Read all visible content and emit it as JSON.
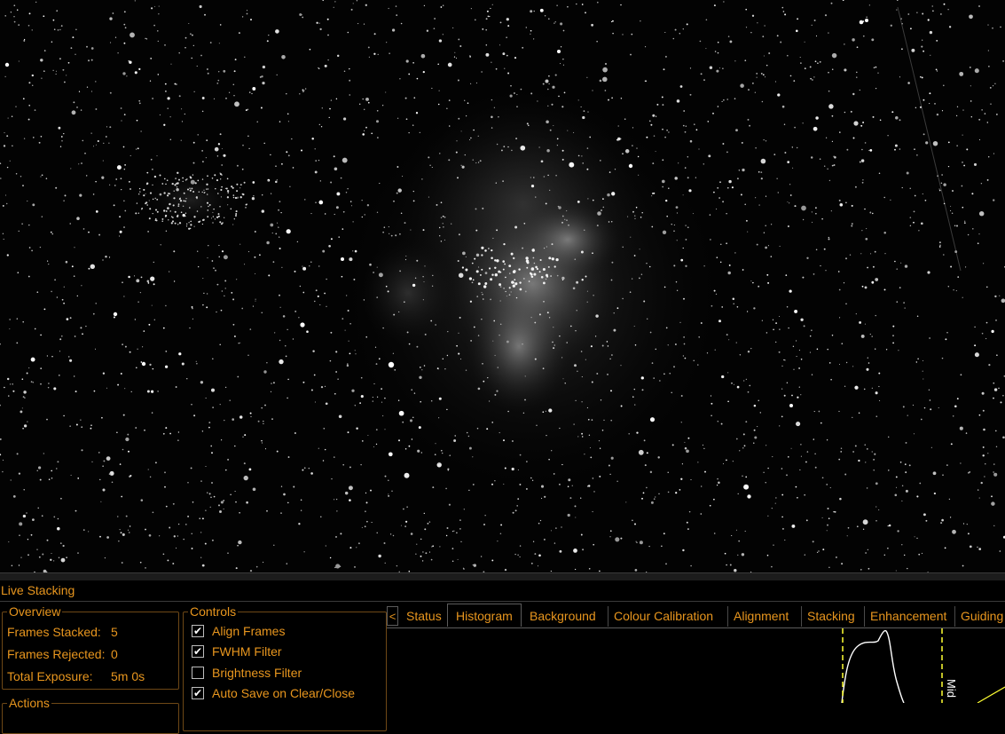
{
  "image": {
    "name": "live-stack-preview",
    "subject": "Eagle Nebula star field"
  },
  "panel": {
    "title": "Live Stacking"
  },
  "overview": {
    "legend": "Overview",
    "rows": [
      {
        "label": "Frames Stacked:",
        "value": "5"
      },
      {
        "label": "Frames Rejected:",
        "value": "0"
      },
      {
        "label": "Total Exposure:",
        "value": "5m 0s"
      }
    ]
  },
  "actions": {
    "legend": "Actions"
  },
  "controls": {
    "legend": "Controls",
    "items": [
      {
        "label": "Align Frames",
        "checked": true,
        "mark": "✔"
      },
      {
        "label": "FWHM Filter",
        "checked": true,
        "mark": "✔"
      },
      {
        "label": "Brightness Filter",
        "checked": false,
        "mark": ""
      },
      {
        "label": "Auto Save on Clear/Close",
        "checked": true,
        "mark": "✔"
      }
    ]
  },
  "tabs": {
    "prev_arrow": "<",
    "items": [
      "Status",
      "Histogram",
      "Background",
      "Colour Calibration",
      "Alignment",
      "Stacking",
      "Enhancement",
      "Guiding"
    ],
    "active": "Histogram"
  },
  "histogram": {
    "marker_label": "Mid",
    "colors": {
      "curve": "#ffffff",
      "marker": "#ffff33",
      "transfer": "#ffff33"
    }
  },
  "colors": {
    "accent": "#e8961e",
    "background": "#000000"
  }
}
